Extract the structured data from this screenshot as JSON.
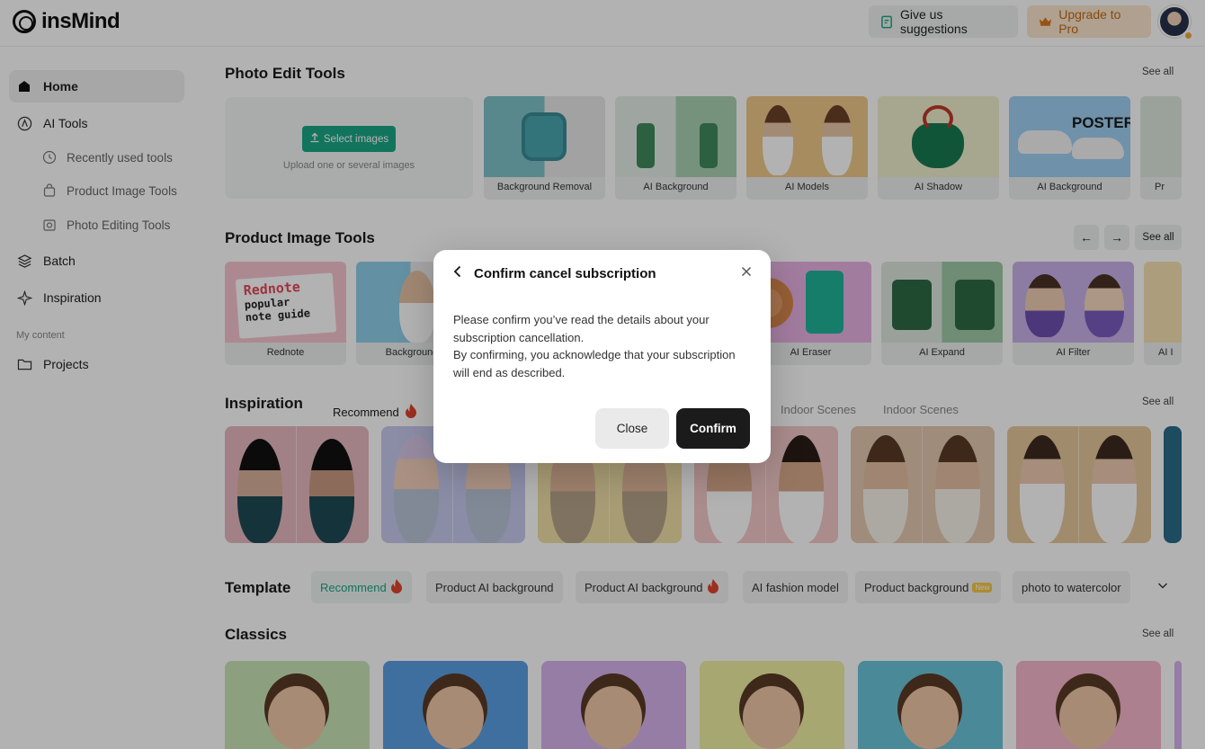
{
  "header": {
    "logo_text": "insMind",
    "suggest_label": "Give us suggestions",
    "upgrade_label": "Upgrade to Pro"
  },
  "sidebar": {
    "home": "Home",
    "ai_tools": "AI Tools",
    "sub": [
      "Recently used tools",
      "Product Image Tools",
      "Photo Editing Tools"
    ],
    "batch": "Batch",
    "inspiration": "Inspiration",
    "my_content": "My content",
    "projects": "Projects"
  },
  "photo_edit": {
    "title": "Photo Edit Tools",
    "see_all": "See all",
    "select_label": "Select images",
    "upload_hint": "Upload one or several images",
    "tools": [
      "Background Removal",
      "AI Background",
      "AI Models",
      "AI Shadow",
      "AI Background",
      "Pr"
    ],
    "poster_text": "POSTER"
  },
  "product_tools": {
    "title": "Product Image Tools",
    "see_all": "See all",
    "tools": [
      "Rednote",
      "Background R",
      "AI Eraser",
      "AI Expand",
      "AI Filter",
      "AI I"
    ],
    "rednote_art": [
      "Rednote",
      "popular",
      "note guide"
    ]
  },
  "inspiration": {
    "title": "Inspiration",
    "tabs": [
      "Recommend",
      "Indoor Scenes",
      "Indoor Scenes"
    ],
    "see_all": "See all"
  },
  "template": {
    "title": "Template",
    "chips": [
      "Recommend",
      "Product AI background",
      "Product AI background",
      "AI fashion model",
      "Product background",
      "photo to watercolor"
    ],
    "new_badge": "New"
  },
  "classics": {
    "title": "Classics",
    "see_all": "See all"
  },
  "modal": {
    "title": "Confirm cancel subscription",
    "body_line1": "Please confirm you’ve read the details about your subscription cancellation.",
    "body_line2": "By confirming, you acknowledge that your subscription will end as described.",
    "close_label": "Close",
    "confirm_label": "Confirm"
  },
  "colors": {
    "accent_green": "#1aa784",
    "upgrade_orange": "#c26a0e",
    "confirm_black": "#1b1b1b"
  }
}
